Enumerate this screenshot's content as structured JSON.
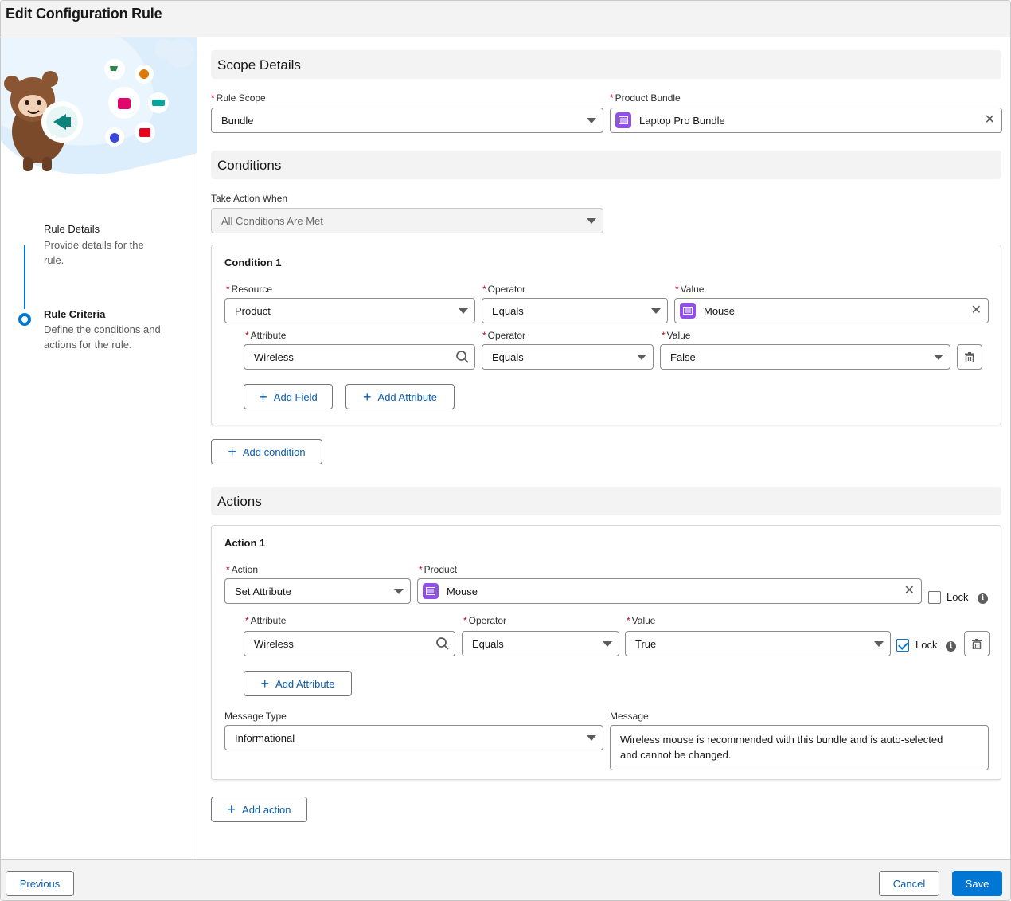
{
  "header": {
    "title": "Edit Configuration Rule"
  },
  "sidebar": {
    "steps": [
      {
        "title": "Rule Details",
        "description_line1": "Provide details for the",
        "description_line2": "rule."
      },
      {
        "title": "Rule Criteria",
        "description_line1": "Define the conditions and",
        "description_line2": "actions for the rule."
      }
    ]
  },
  "scope": {
    "heading": "Scope Details",
    "rule_scope_label": "Rule Scope",
    "rule_scope_value": "Bundle",
    "product_bundle_label": "Product Bundle",
    "product_bundle_value": "Laptop Pro Bundle"
  },
  "conditions": {
    "heading": "Conditions",
    "take_action_label": "Take Action When",
    "take_action_value": "All Conditions Are Met",
    "condition1": {
      "title": "Condition 1",
      "resource_label": "Resource",
      "resource_value": "Product",
      "operator_label": "Operator",
      "operator_value": "Equals",
      "value_label": "Value",
      "value_value": "Mouse",
      "attribute_label": "Attribute",
      "attribute_value": "Wireless",
      "attr_operator_label": "Operator",
      "attr_operator_value": "Equals",
      "attr_value_label": "Value",
      "attr_value_value": "False",
      "add_field": "Add Field",
      "add_attribute": "Add Attribute"
    },
    "add_condition": "Add condition"
  },
  "actions": {
    "heading": "Actions",
    "action1": {
      "title": "Action 1",
      "action_label": "Action",
      "action_value": "Set Attribute",
      "product_label": "Product",
      "product_value": "Mouse",
      "lock_label": "Lock",
      "lock_checked": false,
      "attribute_label": "Attribute",
      "attribute_value": "Wireless",
      "operator_label": "Operator",
      "operator_value": "Equals",
      "value_label": "Value",
      "value_value": "True",
      "attr_lock_label": "Lock",
      "attr_lock_checked": true,
      "add_attribute": "Add Attribute",
      "message_type_label": "Message Type",
      "message_type_value": "Informational",
      "message_label": "Message",
      "message_line1": "Wireless mouse is recommended with this bundle and is auto-selected",
      "message_line2": "and cannot be changed."
    },
    "add_action": "Add action"
  },
  "footer": {
    "previous": "Previous",
    "cancel": "Cancel",
    "save": "Save"
  },
  "colors": {
    "brand": "#0176d3",
    "link": "#0b5cab",
    "required": "#ba0517",
    "bundle_icon": "#9050e9"
  },
  "icons": [
    "caret-down-icon",
    "clear-icon",
    "search-icon",
    "bundle-icon",
    "delete-icon",
    "info-icon",
    "add-icon",
    "mascot-illustration"
  ]
}
